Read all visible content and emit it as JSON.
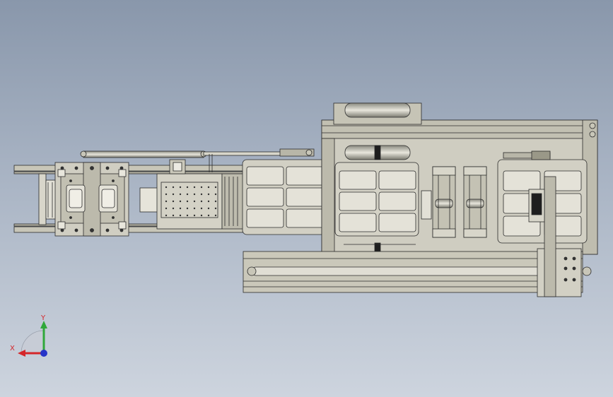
{
  "viewport": {
    "background_top": "#8997ab",
    "background_bottom": "#cdd4de",
    "part_fill": "#c8c6b8",
    "part_fill_light": "#d8d6ca",
    "part_stroke": "#2b2b2b"
  },
  "triad": {
    "x_label": "X",
    "y_label": "Y",
    "x_color": "#d4262a",
    "y_color": "#2fa83a",
    "z_color": "#2634c8"
  }
}
